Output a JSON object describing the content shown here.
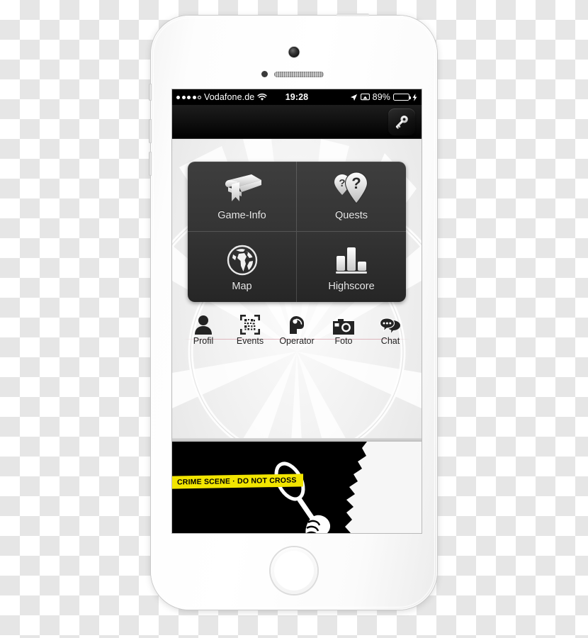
{
  "device": {
    "name": "iPhone 5s white",
    "parts": [
      "front-camera",
      "proximity-sensor",
      "earpiece-speaker",
      "home-button",
      "volume-buttons",
      "mute-switch",
      "power-button"
    ]
  },
  "status_bar": {
    "signal_label": "signal-dots",
    "signal_bars_filled": 4,
    "signal_bars_total": 5,
    "carrier": "Vodafone.de",
    "wifi_icon": "wifi-icon",
    "time": "19:28",
    "location_icon": "location-arrow-icon",
    "airplay_icon": "airplay-icon",
    "battery_percent": "89%",
    "battery_level": 89,
    "battery_color": "#4cd964",
    "charging_icon": "lightning-bolt-icon"
  },
  "nav_bar": {
    "key_button_icon": "key-icon",
    "key_button_label": "Key"
  },
  "menu_grid": {
    "tiles": [
      {
        "label": "Game-Info",
        "icon": "book-icon"
      },
      {
        "label": "Quests",
        "icon": "map-pin-question-icon"
      },
      {
        "label": "Map",
        "icon": "globe-icon"
      },
      {
        "label": "Highscore",
        "icon": "bar-chart-icon"
      }
    ]
  },
  "icon_row": {
    "items": [
      {
        "label": "Profil",
        "icon": "person-icon"
      },
      {
        "label": "Events",
        "icon": "qr-code-scan-icon"
      },
      {
        "label": "Operator",
        "icon": "headset-operator-icon"
      },
      {
        "label": "Foto",
        "icon": "camera-icon"
      },
      {
        "label": "Chat",
        "icon": "speech-bubbles-icon"
      }
    ]
  },
  "banner": {
    "tape_text": "CRIME SCENE · DO NOT CROSS",
    "tape_color": "#f2e500",
    "background_color": "#000000",
    "artwork": "detective-silhouette-with-magnifier"
  },
  "colors": {
    "tile_dark": "#343434",
    "screen_background": "#eeeeee",
    "accent_yellow": "#f2e500",
    "battery_green": "#4cd964",
    "row_line": "#ce8491"
  }
}
